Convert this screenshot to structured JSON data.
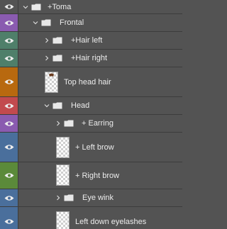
{
  "layers_panel": {
    "rows": [
      {
        "label": "+Toma",
        "type": "group",
        "expanded": true,
        "depth": 0,
        "eye_color": "#535353"
      },
      {
        "label": "Frontal",
        "type": "group",
        "expanded": true,
        "depth": 1,
        "eye_color": "#8a5bb0"
      },
      {
        "label": "+Hair left",
        "type": "group",
        "expanded": false,
        "depth": 2,
        "eye_color": "#4f7f6a"
      },
      {
        "label": "+Hair right",
        "type": "group",
        "expanded": false,
        "depth": 2,
        "eye_color": "#4f7f6a"
      },
      {
        "label": "Top head hair",
        "type": "layer",
        "depth": 2,
        "eye_color": "#b8690f"
      },
      {
        "label": "Head",
        "type": "group",
        "expanded": true,
        "depth": 2,
        "eye_color": "#c24a4e"
      },
      {
        "label": "+ Earring",
        "type": "group",
        "expanded": false,
        "depth": 3,
        "eye_color": "#8a5bb0"
      },
      {
        "label": "+ Left brow",
        "type": "layer",
        "depth": 3,
        "eye_color": "#4a6f9c"
      },
      {
        "label": "+ Right brow",
        "type": "layer",
        "depth": 3,
        "eye_color": "#5b8a3a"
      },
      {
        "label": "Eye wink",
        "type": "group",
        "expanded": false,
        "depth": 3,
        "eye_color": "#4a6f9c"
      },
      {
        "label": "Left down eyelashes",
        "type": "layer",
        "depth": 3,
        "eye_color": "#4a6f9c"
      }
    ]
  }
}
